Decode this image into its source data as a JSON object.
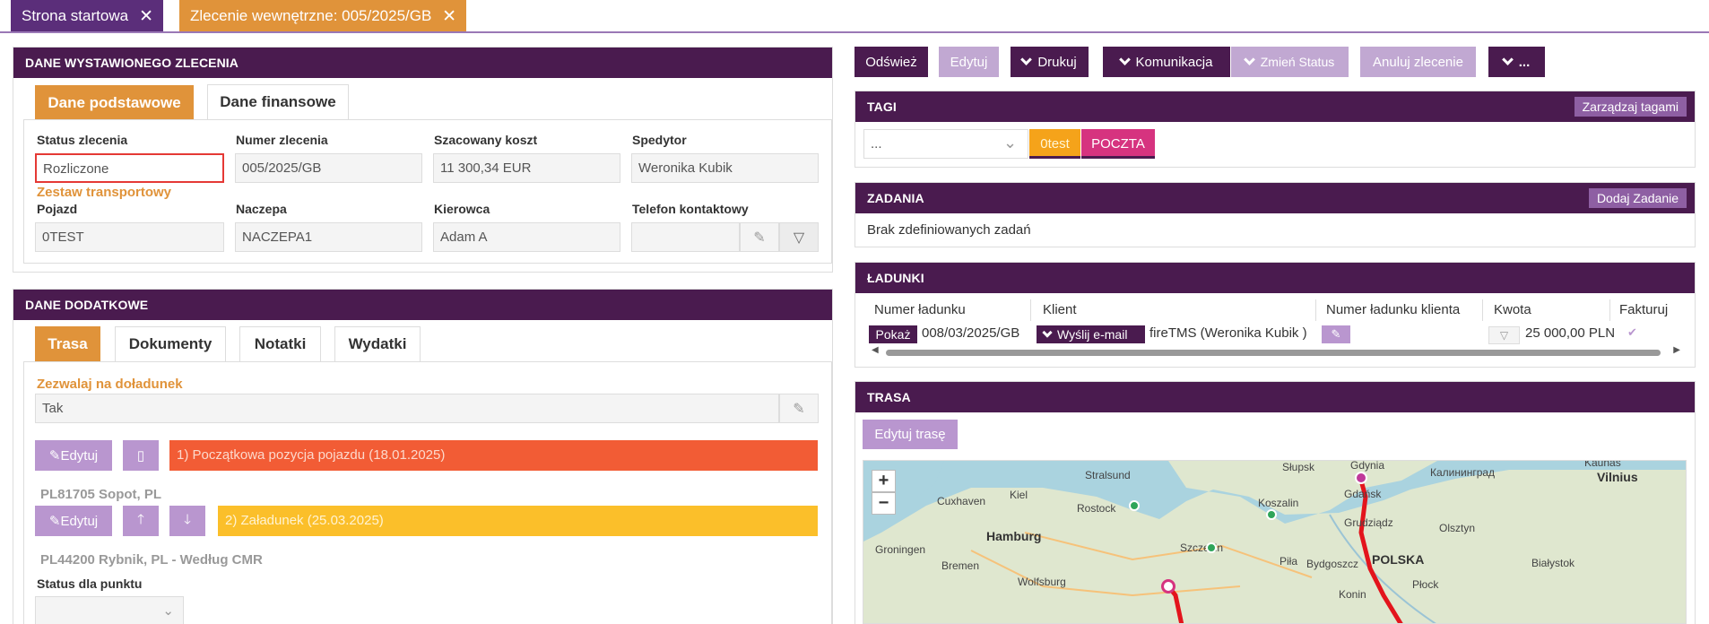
{
  "tabs": [
    {
      "label": "Strona startowa"
    },
    {
      "label": "Zlecenie wewnętrzne: 005/2025/GB"
    }
  ],
  "left": {
    "order_panel": {
      "title": "DANE WYSTAWIONEGO ZLECENIA",
      "subtabs": [
        "Dane podstawowe",
        "Dane finansowe"
      ],
      "fields": {
        "status_label": "Status zlecenia",
        "status_value": "Rozliczone",
        "number_label": "Numer zlecenia",
        "number_value": "005/2025/GB",
        "cost_label": "Szacowany koszt",
        "cost_value": "11 300,34 EUR",
        "forwarder_label": "Spedytor",
        "forwarder_value": "Weronika Kubik",
        "set_label": "Zestaw transportowy",
        "vehicle_label": "Pojazd",
        "vehicle_value": "0TEST",
        "trailer_label": "Naczepa",
        "trailer_value": "NACZEPA1",
        "driver_label": "Kierowca",
        "driver_value": "Adam A",
        "phone_label": "Telefon kontaktowy",
        "phone_value": ""
      }
    },
    "extra_panel": {
      "title": "DANE DODATKOWE",
      "subtabs": [
        "Trasa",
        "Dokumenty",
        "Notatki",
        "Wydatki"
      ],
      "reload_label": "Zezwalaj na doładunek",
      "reload_value": "Tak",
      "edit_label": "Edytuj",
      "point1": "1) Początkowa pozycja pojazdu (18.01.2025)",
      "point1_place": "PL81705 Sopot, PL",
      "point2": "2) Załadunek (25.03.2025)",
      "point2_place": "PL44200 Rybnik, PL - Według CMR",
      "point_status_label": "Status dla punktu"
    }
  },
  "toolbar": [
    "Odśwież",
    "Edytuj",
    "Drukuj",
    "Komunikacja",
    "Zmień Status",
    "Anuluj zlecenie",
    "..."
  ],
  "tags": {
    "title": "TAGI",
    "manage": "Zarządzaj tagami",
    "select_placeholder": "...",
    "items": [
      "0test",
      "POCZTA"
    ]
  },
  "tasks": {
    "title": "ZADANIA",
    "add": "Dodaj Zadanie",
    "empty": "Brak zdefiniowanych zadań"
  },
  "loads": {
    "title": "ŁADUNKI",
    "headers": [
      "Numer ładunku",
      "Klient",
      "Numer ładunku klienta",
      "Kwota",
      "Fakturuj"
    ],
    "row": {
      "show": "Pokaż",
      "number": "008/03/2025/GB",
      "send_email": "Wyślij e-mail",
      "client": "fireTMS (Weronika Kubik )",
      "amount": "25 000,00 PLN"
    }
  },
  "route": {
    "title": "TRASA",
    "edit": "Edytuj trasę",
    "zoom_in": "+",
    "zoom_out": "−",
    "labels": [
      "Słupsk",
      "Gdynia",
      "Kaliningrad",
      "Kaunas",
      "Vilnius",
      "Stralsund",
      "Kiel",
      "Gdańsk",
      "Калининград",
      "Cuxhaven",
      "Rostock",
      "Koszalin",
      "Grudziądz",
      "Olsztyn",
      "Hamburg",
      "Szczecin",
      "Bydgoszcz",
      "POLSKA",
      "Groningen",
      "Bremen",
      "Piła",
      "Białystok",
      "Wolfsburg",
      "Płock",
      "Konin"
    ]
  },
  "colors": {
    "purple_dark": "#4a1b4f",
    "purple_light": "#b996cf",
    "orange": "#e0933a",
    "red_bar": "#f25c35",
    "yellow_bar": "#fbbf2a",
    "pink": "#d6337f"
  }
}
